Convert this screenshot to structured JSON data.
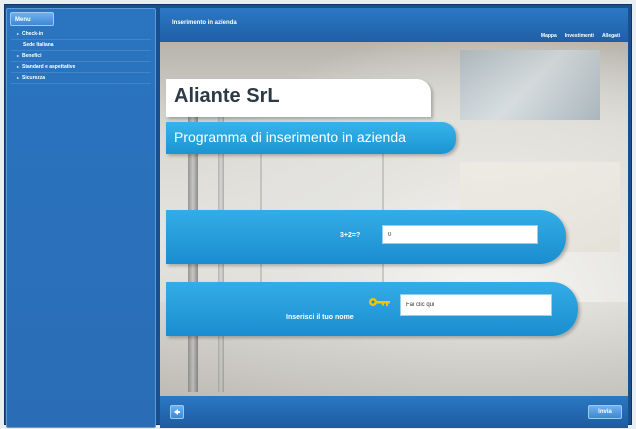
{
  "sidebar": {
    "menu_tab": "Menu",
    "items": [
      {
        "label": "Check-in",
        "arrow": true
      },
      {
        "label": "Sede Italiana",
        "arrow": false
      },
      {
        "label": "Benefici",
        "arrow": true
      },
      {
        "label": "Standard e aspettative",
        "arrow": true
      },
      {
        "label": "Sicurezza",
        "arrow": true
      }
    ]
  },
  "header": {
    "title": "Inserimento in azienda",
    "links": [
      "Mappa",
      "Investimenti",
      "Allegati"
    ]
  },
  "content": {
    "company_name": "Aliante SrL",
    "program_title": "Programma di inserimento in azienda",
    "question_label": "3+2=?",
    "question_value": "0",
    "name_label": "Inserisci il tuo nome",
    "name_value": "Fai clic qui"
  },
  "footer": {
    "back_icon": "arrow-left-icon",
    "send_label": "Invia"
  },
  "colors": {
    "frame": "#1a4f8f",
    "panel_blue": "#1a8dcf",
    "key": "#f5c400"
  }
}
